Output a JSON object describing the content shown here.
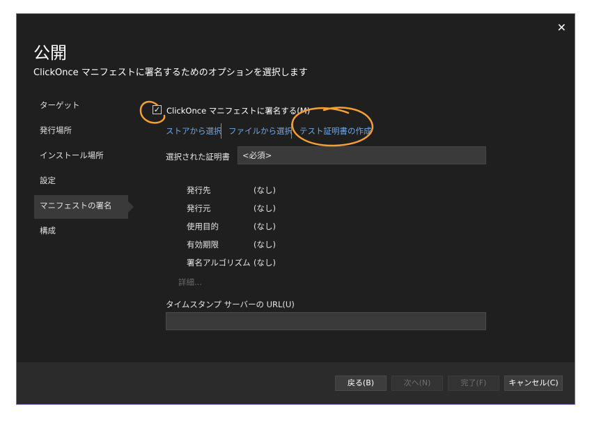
{
  "dialog": {
    "close_glyph": "✕",
    "title": "公開",
    "subtitle": "ClickOnce マニフェストに署名するためのオプションを選択します"
  },
  "nav": {
    "items": [
      {
        "label": "ターゲット"
      },
      {
        "label": "発行場所"
      },
      {
        "label": "インストール場所"
      },
      {
        "label": "設定"
      },
      {
        "label": "マニフェストの署名",
        "active": true
      },
      {
        "label": "構成"
      }
    ]
  },
  "sign": {
    "checkbox_label": "ClickOnce マニフェストに署名する(M)",
    "checked": true,
    "check_glyph": "✓"
  },
  "links": {
    "store": "ストアから選択",
    "file": "ファイルから選択",
    "test_cert": "テスト証明書の作成"
  },
  "certificate": {
    "label": "選択された証明書",
    "value": "<必須>"
  },
  "details": [
    {
      "key": "発行先",
      "value": "(なし)"
    },
    {
      "key": "発行元",
      "value": "(なし)"
    },
    {
      "key": "使用目的",
      "value": "(なし)"
    },
    {
      "key": "有効期限",
      "value": "(なし)"
    },
    {
      "key": "署名アルゴリズム",
      "value": "(なし)"
    }
  ],
  "more_link": "詳細...",
  "timestamp": {
    "label": "タイムスタンプ サーバーの URL(U)",
    "value": ""
  },
  "footer": {
    "back": "戻る(B)",
    "next": "次へ(N)",
    "finish": "完了(F)",
    "cancel": "キャンセル(C)"
  },
  "colors": {
    "background": "#1f1f1f",
    "border": "#7f6fc4",
    "link": "#6ea8e6",
    "annotation": "#f5a030"
  }
}
